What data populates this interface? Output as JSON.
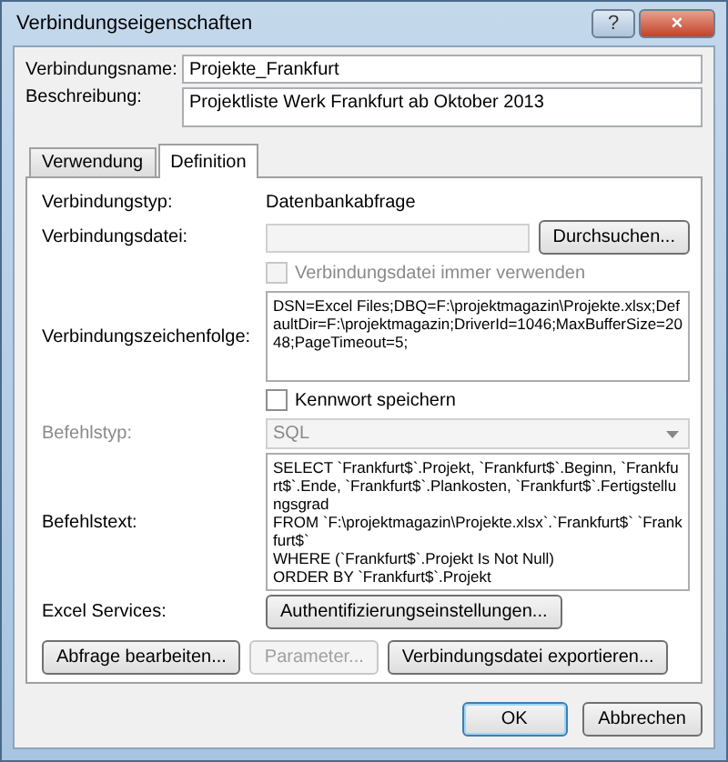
{
  "window": {
    "title": "Verbindungseigenschaften",
    "help": "?",
    "close": "×"
  },
  "name": {
    "label": "Verbindungsname:",
    "value": "Projekte_Frankfurt"
  },
  "description": {
    "label": "Beschreibung:",
    "value": "Projektliste Werk Frankfurt ab Oktober 2013"
  },
  "tabs": [
    {
      "label": "Verwendung",
      "selected": false
    },
    {
      "label": "Definition",
      "selected": true
    }
  ],
  "definition": {
    "type": {
      "label": "Verbindungstyp:",
      "value": "Datenbankabfrage"
    },
    "file": {
      "label": "Verbindungsdatei:",
      "browse": "Durchsuchen...",
      "disabled": true
    },
    "always_use": {
      "label": "Verbindungsdatei immer verwenden",
      "checked": false,
      "disabled": true
    },
    "connection_string": {
      "label": "Verbindungszeichenfolge:",
      "value": "DSN=Excel Files;DBQ=F:\\projektmagazin\\Projekte.xlsx;DefaultDir=F:\\projektmagazin;DriverId=1046;MaxBufferSize=2048;PageTimeout=5;"
    },
    "save_password": {
      "label": "Kennwort speichern",
      "checked": false,
      "disabled": false
    },
    "command_type": {
      "label": "Befehlstyp:",
      "value": "SQL",
      "disabled": true
    },
    "command_text": {
      "label": "Befehlstext:",
      "value": "SELECT `Frankfurt$`.Projekt, `Frankfurt$`.Beginn, `Frankfurt$`.Ende, `Frankfurt$`.Plankosten, `Frankfurt$`.Fertigstellungsgrad\nFROM `F:\\projektmagazin\\Projekte.xlsx`.`Frankfurt$` `Frankfurt$`\nWHERE (`Frankfurt$`.Projekt Is Not Null)\nORDER BY `Frankfurt$`.Projekt"
    },
    "excel_services": {
      "label": "Excel Services:",
      "button": "Authentifizierungseinstellungen..."
    },
    "buttons": [
      {
        "label": "Abfrage bearbeiten...",
        "disabled": false
      },
      {
        "label": "Parameter...",
        "disabled": true
      },
      {
        "label": "Verbindungsdatei exportieren...",
        "disabled": false
      }
    ]
  },
  "footer": [
    {
      "label": "OK",
      "default": true
    },
    {
      "label": "Abbrechen",
      "default": false
    }
  ]
}
